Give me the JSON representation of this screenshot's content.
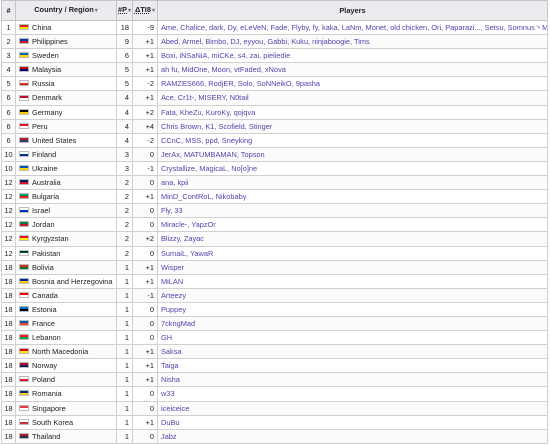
{
  "headers": {
    "rank": "#",
    "country": "Country / Region",
    "count": "#P",
    "delta": "ΔTI8",
    "players": "Players"
  },
  "sort_icon": "▾",
  "rows": [
    {
      "rank": "1",
      "country": "China",
      "count": "18",
      "delta": "-9",
      "players": "Ame, Chalice, dark, Dy, eLeVeN, Fade, Flyby, fy, kaka, LaNm, Monet, old chicken, Ori, Paparazi..., Setsu, Somnus丶M, Yang, ...",
      "flag": [
        "#de2910",
        "#ffde00"
      ]
    },
    {
      "rank": "2",
      "country": "Philippines",
      "count": "9",
      "delta": "+1",
      "players": "Abed, Armel, Bimbo, DJ, eyyou, Gabbi, Kuku, ninjaboogie, Tims",
      "flag": [
        "#0038a8",
        "#ce1126"
      ]
    },
    {
      "rank": "3",
      "country": "Sweden",
      "count": "6",
      "delta": "+1",
      "players": "Boxi, iNSaNiA, miCKe, s4, zai, pieliedie",
      "flag": [
        "#006aa7",
        "#fecc00"
      ]
    },
    {
      "rank": "4",
      "country": "Malaysia",
      "count": "5",
      "delta": "+1",
      "players": "ah fu, MidOne, Moon, vtFaded, xNova",
      "flag": [
        "#cc0001",
        "#010066"
      ]
    },
    {
      "rank": "5",
      "country": "Russia",
      "count": "5",
      "delta": "-2",
      "players": "RAMZES666, RodjER, Solo, SoNNeikO, 9pasha",
      "flag": [
        "#ffffff",
        "#d52b1e"
      ]
    },
    {
      "rank": "6",
      "country": "Denmark",
      "count": "4",
      "delta": "+1",
      "players": "Ace, Cr1t-, MISERY, N0tail",
      "flag": [
        "#c60c30",
        "#ffffff"
      ]
    },
    {
      "rank": "6",
      "country": "Germany",
      "count": "4",
      "delta": "+2",
      "players": "Fata, KheZu, KuroKy, qojqva",
      "flag": [
        "#000000",
        "#ffce00"
      ]
    },
    {
      "rank": "6",
      "country": "Peru",
      "count": "4",
      "delta": "+4",
      "players": "Chris Brown, K1, Scofield, Stinger",
      "flag": [
        "#d91023",
        "#ffffff"
      ]
    },
    {
      "rank": "6",
      "country": "United States",
      "count": "4",
      "delta": "-2",
      "players": "CCnC, MSS, ppd, Sneyking",
      "flag": [
        "#b22234",
        "#3c3b6e"
      ]
    },
    {
      "rank": "10",
      "country": "Finland",
      "count": "3",
      "delta": "0",
      "players": "JerAx, MATUMBAMAN, Topson",
      "flag": [
        "#ffffff",
        "#003580"
      ]
    },
    {
      "rank": "10",
      "country": "Ukraine",
      "count": "3",
      "delta": "-1",
      "players": "Crystallize, MagicaL, No[o]ne",
      "flag": [
        "#0057b7",
        "#ffd700"
      ]
    },
    {
      "rank": "12",
      "country": "Australia",
      "count": "2",
      "delta": "0",
      "players": "ana, kpii",
      "flag": [
        "#012169",
        "#e4002b"
      ]
    },
    {
      "rank": "12",
      "country": "Bulgaria",
      "count": "2",
      "delta": "+1",
      "players": "MinD_ContRoL, Nikobaby",
      "flag": [
        "#00966e",
        "#d62612"
      ]
    },
    {
      "rank": "12",
      "country": "Israel",
      "count": "2",
      "delta": "0",
      "players": "Fly, 33",
      "flag": [
        "#ffffff",
        "#0038b8"
      ]
    },
    {
      "rank": "12",
      "country": "Jordan",
      "count": "2",
      "delta": "0",
      "players": "Miracle-, YapzOr",
      "flag": [
        "#007a3d",
        "#ce1126"
      ]
    },
    {
      "rank": "12",
      "country": "Kyrgyzstan",
      "count": "2",
      "delta": "+2",
      "players": "Blizzy, Zayac",
      "flag": [
        "#e8112d",
        "#ffef00"
      ]
    },
    {
      "rank": "12",
      "country": "Pakistan",
      "count": "2",
      "delta": "0",
      "players": "SumaiL, YawaR",
      "flag": [
        "#01411c",
        "#ffffff"
      ]
    },
    {
      "rank": "18",
      "country": "Bolivia",
      "count": "1",
      "delta": "+1",
      "players": "Wisper",
      "flag": [
        "#d52b1e",
        "#007934"
      ]
    },
    {
      "rank": "18",
      "country": "Bosnia and Herzegovina",
      "count": "1",
      "delta": "+1",
      "players": "MiLAN",
      "flag": [
        "#002395",
        "#fecb00"
      ]
    },
    {
      "rank": "18",
      "country": "Canada",
      "count": "1",
      "delta": "-1",
      "players": "Arteezy",
      "flag": [
        "#ff0000",
        "#ffffff"
      ]
    },
    {
      "rank": "18",
      "country": "Estonia",
      "count": "1",
      "delta": "0",
      "players": "Puppey",
      "flag": [
        "#0072ce",
        "#000000"
      ]
    },
    {
      "rank": "18",
      "country": "France",
      "count": "1",
      "delta": "0",
      "players": "7ckngMad",
      "flag": [
        "#0055a4",
        "#ef4135"
      ]
    },
    {
      "rank": "18",
      "country": "Lebanon",
      "count": "1",
      "delta": "0",
      "players": "GH",
      "flag": [
        "#ee161f",
        "#00a850"
      ]
    },
    {
      "rank": "18",
      "country": "North Macedonia",
      "count": "1",
      "delta": "+1",
      "players": "Saksa",
      "flag": [
        "#d20000",
        "#ffe600"
      ]
    },
    {
      "rank": "18",
      "country": "Norway",
      "count": "1",
      "delta": "+1",
      "players": "Taiga",
      "flag": [
        "#ba0c2f",
        "#00205b"
      ]
    },
    {
      "rank": "18",
      "country": "Poland",
      "count": "1",
      "delta": "+1",
      "players": "Nisha",
      "flag": [
        "#ffffff",
        "#dc143c"
      ]
    },
    {
      "rank": "18",
      "country": "Romania",
      "count": "1",
      "delta": "0",
      "players": "w33",
      "flag": [
        "#002b7f",
        "#fcd116"
      ]
    },
    {
      "rank": "18",
      "country": "Singapore",
      "count": "1",
      "delta": "0",
      "players": "iceiceice",
      "flag": [
        "#ef3340",
        "#ffffff"
      ]
    },
    {
      "rank": "18",
      "country": "South Korea",
      "count": "1",
      "delta": "+1",
      "players": "DuBu",
      "flag": [
        "#ffffff",
        "#cd2e3a"
      ]
    },
    {
      "rank": "18",
      "country": "Thailand",
      "count": "1",
      "delta": "0",
      "players": "Jabz",
      "flag": [
        "#a51931",
        "#2d2a4a"
      ]
    }
  ]
}
